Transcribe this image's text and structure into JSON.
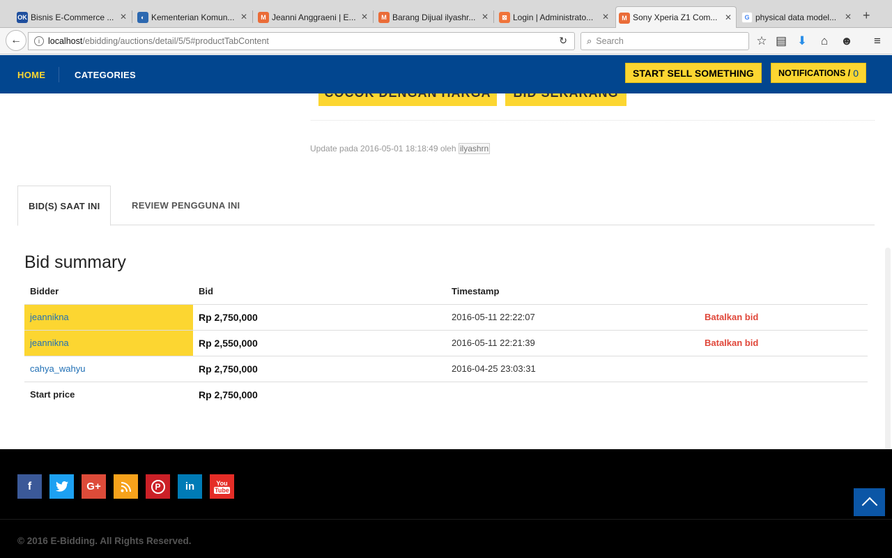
{
  "browser": {
    "tabs": [
      {
        "label": "Bisnis E-Commerce ...",
        "favicon": "ok-icon",
        "color": "#1f4f9e",
        "glyph": "OK"
      },
      {
        "label": "Kementerian Komun...",
        "favicon": "ministry-icon",
        "color": "#2c68b0",
        "glyph": "◐"
      },
      {
        "label": "Jeanni Anggraeni | E...",
        "favicon": "magento-icon",
        "color": "#ea6c38",
        "glyph": "M"
      },
      {
        "label": "Barang Dijual ilyashr...",
        "favicon": "magento-icon",
        "color": "#ea6c38",
        "glyph": "M"
      },
      {
        "label": "Login | Administrato...",
        "favicon": "xampp-icon",
        "color": "#f0743a",
        "glyph": "⊠"
      },
      {
        "label": "Sony Xperia Z1 Com...",
        "favicon": "magento-icon",
        "color": "#ea6c38",
        "glyph": "M",
        "active": true
      },
      {
        "label": "physical data model...",
        "favicon": "google-icon",
        "color": "#4285f4",
        "glyph": "G"
      }
    ],
    "url_host": "localhost",
    "url_path": "/ebidding/auctions/detail/5/5#productTabContent",
    "search_placeholder": "Search"
  },
  "site": {
    "nav": {
      "home": "HOME",
      "categories": "CATEGORIES"
    },
    "sell_button": "START SELL SOMETHING",
    "notifications_label": "NOTIFICATIONS /",
    "notifications_count": "0",
    "brand_color": "#02468f",
    "accent_color": "#fcd631"
  },
  "product": {
    "buy_button": "COCOK DENGAN HARGA",
    "bid_button": "BID SEKARANG",
    "updated_prefix": "Update pada 2016-05-01 18:18:49 oleh",
    "updated_user": "ilyashrn"
  },
  "tabs": {
    "bids": "BID(S) SAAT INI",
    "reviews": "REVIEW PENGGUNA INI"
  },
  "bid_summary": {
    "title": "Bid summary",
    "columns": [
      "Bidder",
      "Bid",
      "Timestamp",
      ""
    ],
    "rows": [
      {
        "bidder": "jeannikna",
        "bid": "Rp 2,750,000",
        "timestamp": "2016-05-11 22:22:07",
        "action": "Batalkan bid",
        "highlight": true
      },
      {
        "bidder": "jeannikna",
        "bid": "Rp 2,550,000",
        "timestamp": "2016-05-11 22:21:39",
        "action": "Batalkan bid",
        "highlight": true
      },
      {
        "bidder": "cahya_wahyu",
        "bid": "Rp 2,750,000",
        "timestamp": "2016-04-25 23:03:31",
        "action": "",
        "highlight": false
      }
    ],
    "start_label": "Start price",
    "start_price": "Rp 2,750,000"
  },
  "footer": {
    "social": [
      {
        "name": "facebook",
        "glyph": "f",
        "color": "#3b5998"
      },
      {
        "name": "twitter",
        "glyph": "t",
        "color": "#1da1f2"
      },
      {
        "name": "google-plus",
        "glyph": "G+",
        "color": "#dd4b39"
      },
      {
        "name": "rss",
        "glyph": "◉",
        "color": "#f7a21b"
      },
      {
        "name": "pinterest",
        "glyph": "P",
        "color": "#cb2027"
      },
      {
        "name": "linkedin",
        "glyph": "in",
        "color": "#007bb6"
      },
      {
        "name": "youtube",
        "glyph": "▶",
        "color": "#e52d27"
      }
    ],
    "copyright": "© 2016 E-Bidding. All Rights Reserved."
  }
}
